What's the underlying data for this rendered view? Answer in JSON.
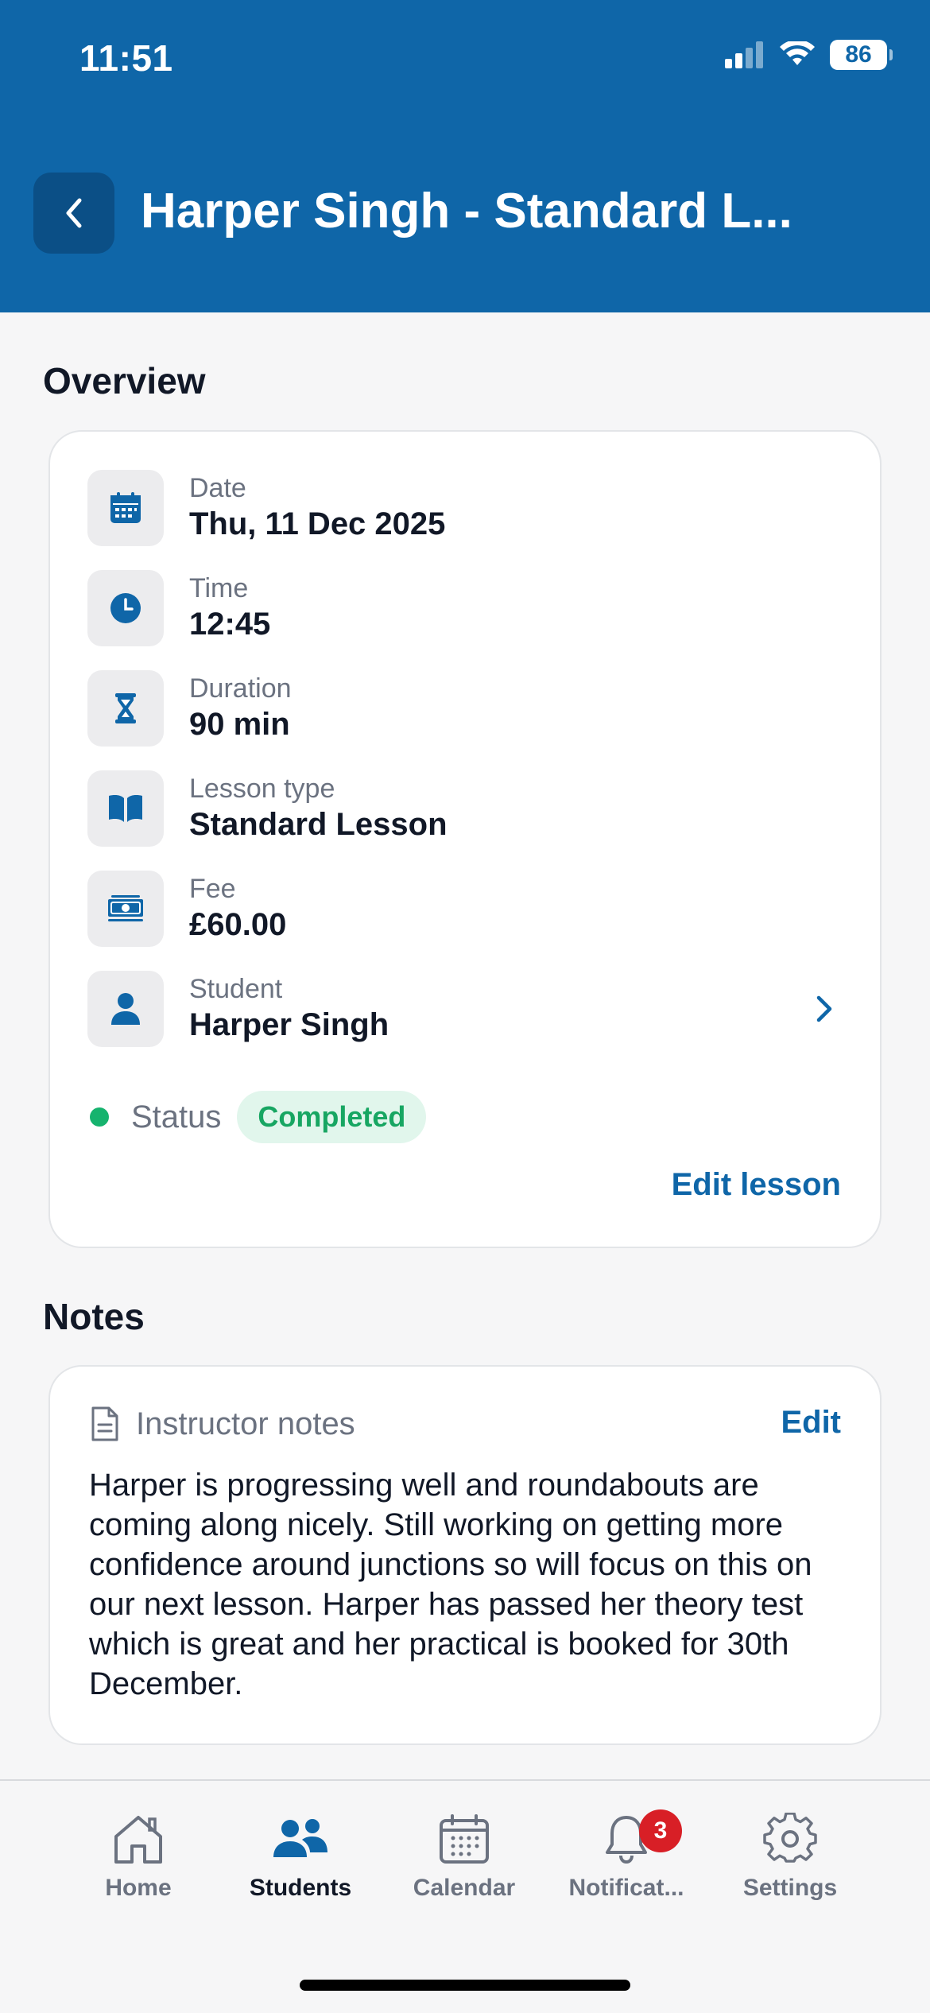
{
  "status_bar": {
    "time": "11:51",
    "battery": "86"
  },
  "header": {
    "title": "Harper Singh - Standard L..."
  },
  "overview": {
    "section_title": "Overview",
    "rows": [
      {
        "label": "Date",
        "value": "Thu, 11 Dec 2025",
        "icon": "calendar-icon"
      },
      {
        "label": "Time",
        "value": "12:45",
        "icon": "clock-icon"
      },
      {
        "label": "Duration",
        "value": "90 min",
        "icon": "hourglass-icon"
      },
      {
        "label": "Lesson type",
        "value": "Standard Lesson",
        "icon": "book-icon"
      },
      {
        "label": "Fee",
        "value": "£60.00",
        "icon": "banknote-icon"
      },
      {
        "label": "Student",
        "value": "Harper Singh",
        "icon": "person-icon"
      }
    ],
    "status_label": "Status",
    "status_value": "Completed",
    "edit_lesson": "Edit lesson"
  },
  "notes": {
    "section_title": "Notes",
    "label": "Instructor notes",
    "edit": "Edit",
    "body": "Harper is progressing well and roundabouts are coming along nicely. Still working on getting more confidence around junctions so will focus on this on our next lesson. Harper has passed her theory test which is great and her practical is booked for 30th December."
  },
  "tabbar": {
    "items": [
      {
        "label": "Home",
        "icon": "home-icon"
      },
      {
        "label": "Students",
        "icon": "students-icon",
        "active": true
      },
      {
        "label": "Calendar",
        "icon": "calendar-icon"
      },
      {
        "label": "Notificat...",
        "icon": "bell-icon",
        "badge": "3"
      },
      {
        "label": "Settings",
        "icon": "gear-icon"
      }
    ]
  },
  "colors": {
    "brand": "#0f66a8",
    "status_green": "#16b36e",
    "badge_red": "#d81f26"
  }
}
